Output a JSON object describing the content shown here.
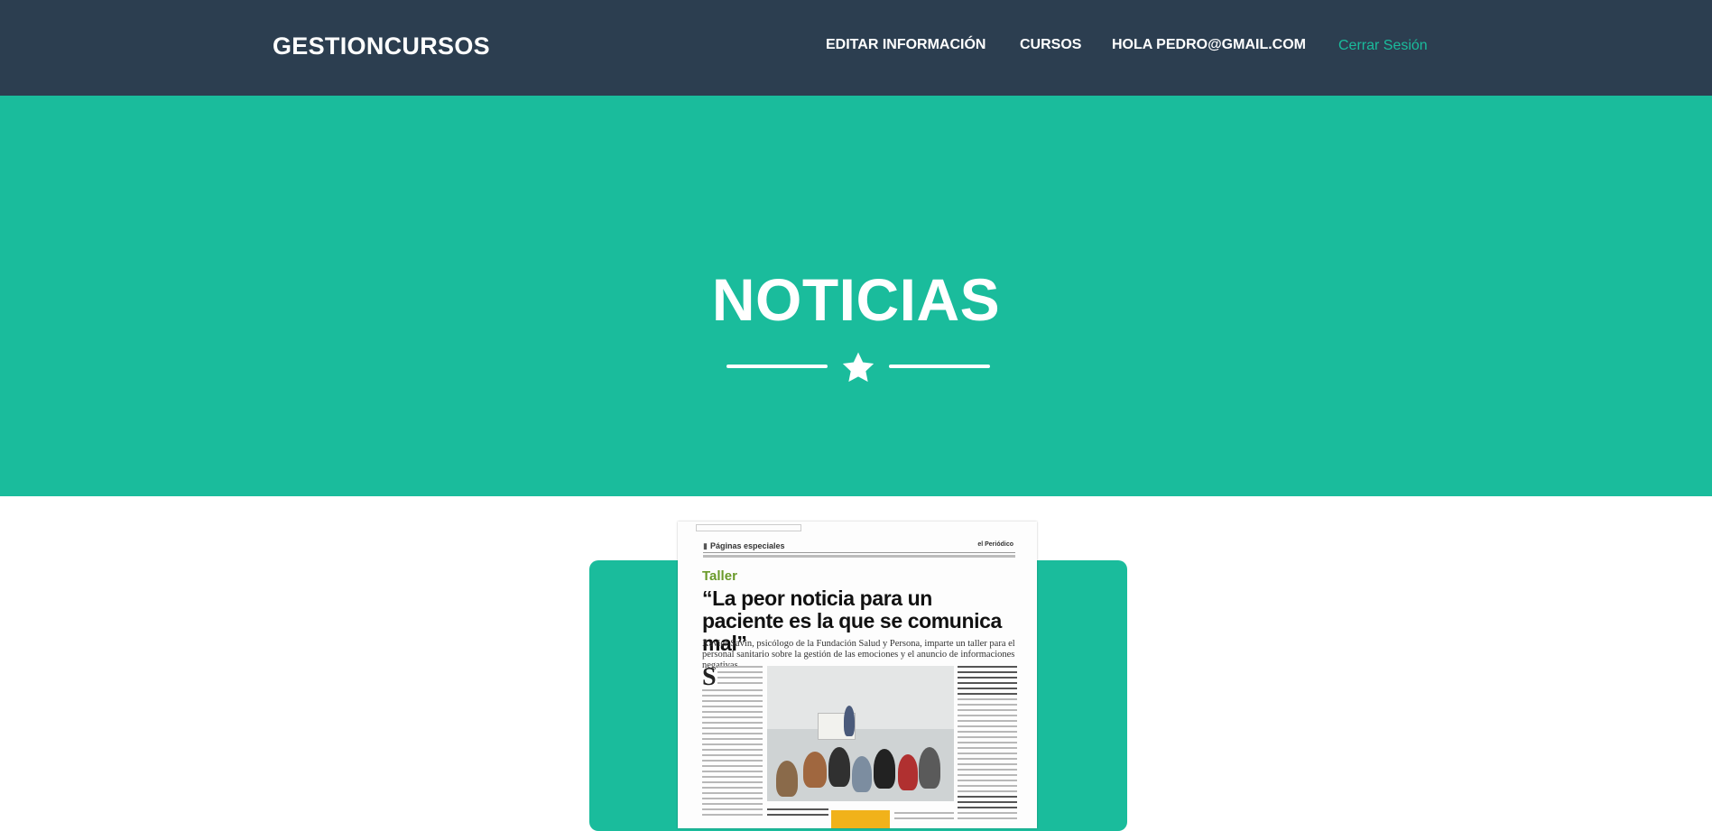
{
  "navbar": {
    "brand": "GESTIONCURSOS",
    "links": [
      "EDITAR INFORMACIÓN",
      "CURSOS",
      "HOLA PEDRO@GMAIL.COM"
    ],
    "logout": "Cerrar Sesión"
  },
  "hero": {
    "title": "NOTICIAS",
    "divider_icon": "star-icon"
  },
  "news": {
    "section": "Páginas especiales",
    "paper": "el Periódico",
    "kicker": "Taller",
    "headline": "“La peor noticia para un paciente es la que se comunica mal”",
    "deck": "Xavier Savin, psicólogo de la Fundación Salud y Persona, imparte un taller para el personal sanitario sobre la gestión de las emociones y el anuncio de informaciones negativas",
    "dropcap": "S"
  },
  "colors": {
    "navbar": "#2c3e50",
    "accent": "#1abc9c",
    "text_light": "#ffffff"
  }
}
